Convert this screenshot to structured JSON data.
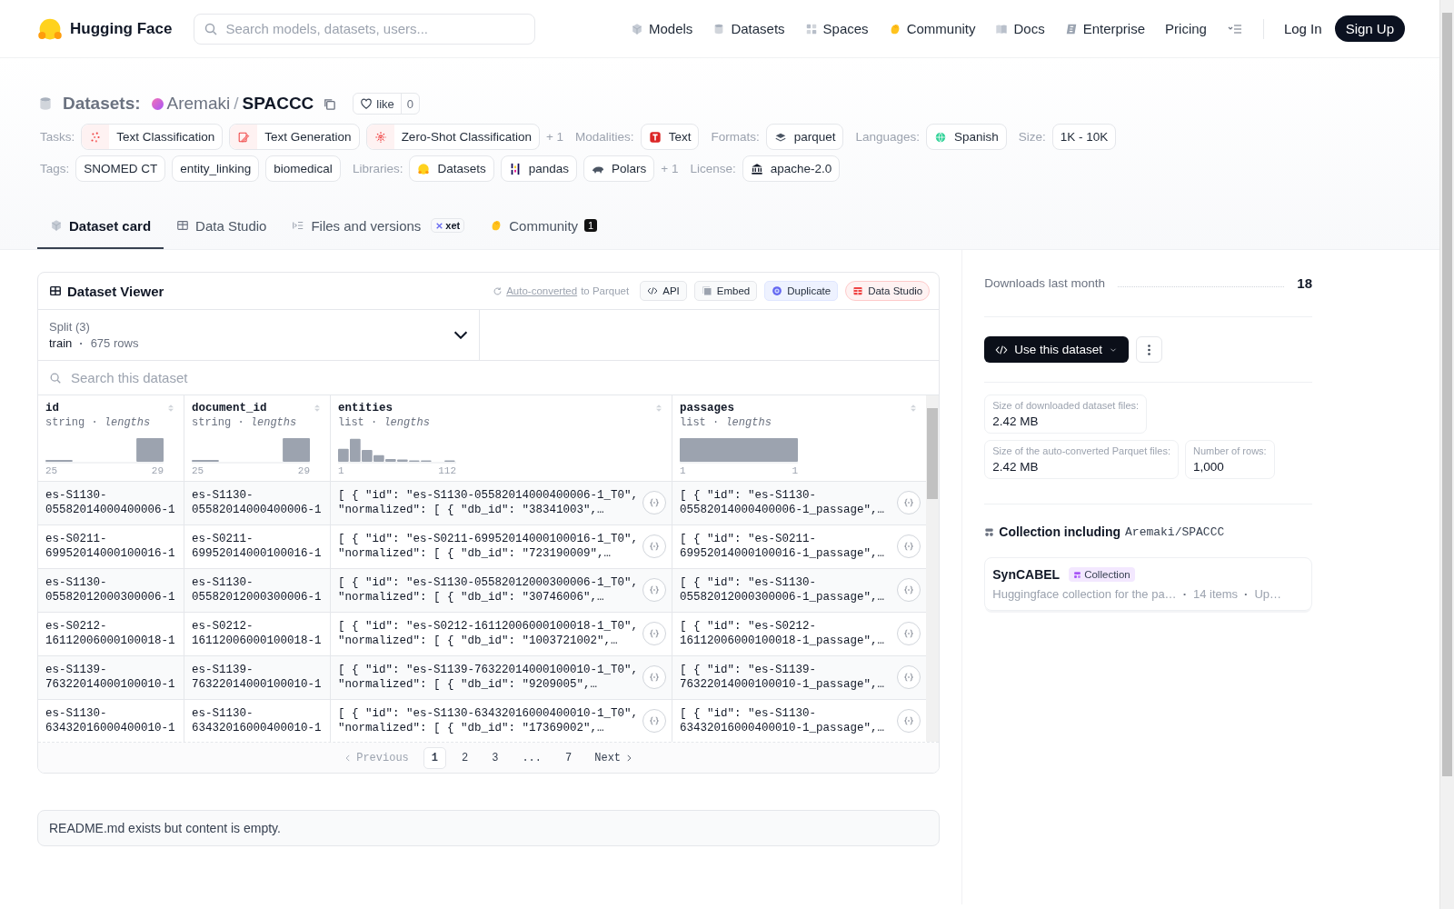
{
  "header": {
    "brand": "Hugging Face",
    "search": {
      "placeholder": "Search models, datasets, users..."
    },
    "nav": [
      {
        "label": "Models"
      },
      {
        "label": "Datasets"
      },
      {
        "label": "Spaces"
      },
      {
        "label": "Community"
      },
      {
        "label": "Docs"
      },
      {
        "label": "Enterprise"
      },
      {
        "label": "Pricing"
      }
    ],
    "login": "Log In",
    "signup": "Sign Up"
  },
  "repo": {
    "section": "Datasets:",
    "owner": "Aremaki",
    "separator": "/",
    "name": "SPACCC",
    "like": {
      "label": "like",
      "count": "0"
    }
  },
  "metadata_rows": [
    [
      {
        "label": "Tasks:",
        "chips": [
          {
            "label": "Text Classification"
          },
          {
            "label": "Text Generation"
          },
          {
            "label": "Zero-Shot Classification"
          }
        ],
        "more": "+ 1"
      },
      {
        "label": "Modalities:",
        "chips": [
          {
            "label": "Text"
          }
        ]
      },
      {
        "label": "Formats:",
        "chips": [
          {
            "label": "parquet"
          }
        ]
      },
      {
        "label": "Languages:",
        "chips": [
          {
            "label": "Spanish"
          }
        ]
      },
      {
        "label": "Size:",
        "chips": [
          {
            "label": "1K - 10K"
          }
        ]
      }
    ],
    [
      {
        "label": "Tags:",
        "chips": [
          {
            "label": "SNOMED CT"
          },
          {
            "label": "entity_linking"
          },
          {
            "label": "biomedical"
          }
        ]
      },
      {
        "label": "Libraries:",
        "chips": [
          {
            "label": "Datasets"
          },
          {
            "label": "pandas"
          },
          {
            "label": "Polars"
          }
        ],
        "more": "+ 1"
      },
      {
        "label": "License:",
        "chips": [
          {
            "label": "apache-2.0"
          }
        ]
      }
    ]
  ],
  "tabs": [
    {
      "label": "Dataset card",
      "selected": true
    },
    {
      "label": "Data Studio",
      "selected": false
    },
    {
      "label": "Files and versions",
      "selected": false,
      "badge": "xet"
    },
    {
      "label": "Community",
      "selected": false,
      "count": "1"
    }
  ],
  "viewer": {
    "title": "Dataset Viewer",
    "converted_link": "Auto-converted",
    "converted_text": "to Parquet",
    "actions": [
      {
        "label": "API",
        "kind": "code"
      },
      {
        "label": "Embed",
        "kind": "embed"
      },
      {
        "label": "Duplicate",
        "kind": "duplicate"
      },
      {
        "label": "Data Studio",
        "kind": "studio"
      }
    ],
    "split": {
      "label": "Split (3)",
      "value": "train",
      "separator": "·",
      "rows": "675 rows"
    },
    "search": {
      "placeholder": "Search this dataset"
    },
    "columns": [
      {
        "name": "id",
        "subtitle": "string · *lengths*",
        "min": "25",
        "max": "29"
      },
      {
        "name": "document_id",
        "subtitle": "string · *lengths*",
        "min": "25",
        "max": "29"
      },
      {
        "name": "entities",
        "subtitle": "list · *lengths*",
        "min": "1",
        "max": "112"
      },
      {
        "name": "passages",
        "subtitle": "list · *lengths*",
        "min": "1",
        "max": "1"
      }
    ],
    "rows": [
      [
        "es-S1130-05582014000400006-1",
        "es-S1130-05582014000400006-1",
        "[ { \"id\": \"es-S1130-05582014000400006-1_T0\", \"normalized\": [ { \"db_id\": \"38341003\",…",
        "[ { \"id\": \"es-S1130-05582014000400006-1_passage\",…"
      ],
      [
        "es-S0211-69952014000100016-1",
        "es-S0211-69952014000100016-1",
        "[ { \"id\": \"es-S0211-69952014000100016-1_T0\", \"normalized\": [ { \"db_id\": \"723190009\",…",
        "[ { \"id\": \"es-S0211-69952014000100016-1_passage\",…"
      ],
      [
        "es-S1130-05582012000300006-1",
        "es-S1130-05582012000300006-1",
        "[ { \"id\": \"es-S1130-05582012000300006-1_T0\", \"normalized\": [ { \"db_id\": \"30746006\",…",
        "[ { \"id\": \"es-S1130-05582012000300006-1_passage\",…"
      ],
      [
        "es-S0212-16112006000100018-1",
        "es-S0212-16112006000100018-1",
        "[ { \"id\": \"es-S0212-16112006000100018-1_T0\", \"normalized\": [ { \"db_id\": \"1003721002\",…",
        "[ { \"id\": \"es-S0212-16112006000100018-1_passage\",…"
      ],
      [
        "es-S1139-76322014000100010-1",
        "es-S1139-76322014000100010-1",
        "[ { \"id\": \"es-S1139-76322014000100010-1_T0\", \"normalized\": [ { \"db_id\": \"9209005\",…",
        "[ { \"id\": \"es-S1139-76322014000100010-1_passage\",…"
      ],
      [
        "es-S1130-63432016000400010-1",
        "es-S1130-63432016000400010-1",
        "[ { \"id\": \"es-S1130-63432016000400010-1_T0\", \"normalized\": [ { \"db_id\": \"17369002\",…",
        "[ { \"id\": \"es-S1130-63432016000400010-1_passage\",…"
      ]
    ],
    "pagination": {
      "previous": {
        "label": "Previous",
        "disabled": true
      },
      "pages": [
        {
          "label": "1",
          "selected": true
        },
        {
          "label": "2",
          "selected": false
        },
        {
          "label": "3",
          "selected": false
        },
        {
          "label": "...",
          "selected": false
        },
        {
          "label": "7",
          "selected": false
        }
      ],
      "next": {
        "label": "Next",
        "disabled": false
      }
    }
  },
  "readme": "README.md exists but content is empty.",
  "sidebar": {
    "downloads": {
      "label": "Downloads last month",
      "value": "18"
    },
    "use_button": "Use this dataset",
    "stats": [
      {
        "label": "Size of downloaded dataset files:",
        "value": "2.42 MB"
      },
      {
        "label": "Size of the auto-converted Parquet files:",
        "value": "2.42 MB"
      },
      {
        "label": "Number of rows:",
        "value": "1,000"
      }
    ],
    "collection": {
      "heading": "Collection including",
      "repo": "Aremaki/SPACCC",
      "card": {
        "title": "SynCABEL",
        "badge": "Collection",
        "description": "Huggingface collection for the pa…",
        "separators": [
          "·",
          "·"
        ],
        "items": "14 items",
        "updated": "Up…"
      }
    }
  }
}
